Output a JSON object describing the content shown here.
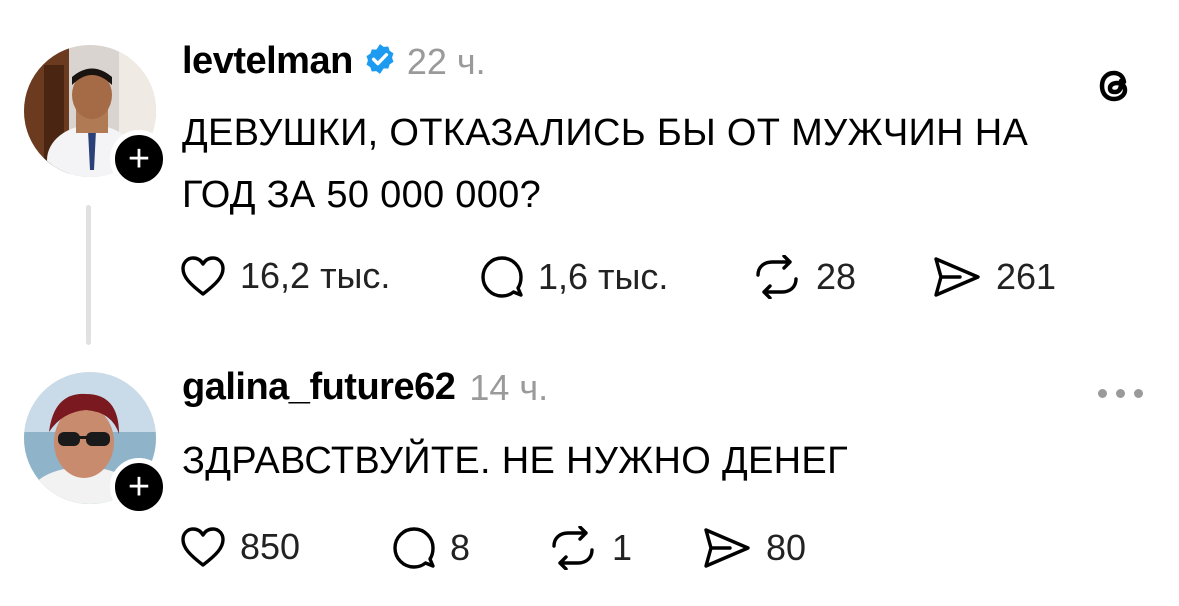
{
  "posts": [
    {
      "username": "levtelman",
      "verified": true,
      "time": "22 ч.",
      "text_line1": "ДЕВУШКИ, ОТКАЗАЛИСЬ БЫ ОТ МУЖЧИН НА",
      "text_line2": "ГОД ЗА 50 000 000?",
      "likes": "16,2 тыс.",
      "replies": "1,6 тыс.",
      "reposts": "28",
      "shares": "261"
    },
    {
      "username": "galina_future62",
      "verified": false,
      "time": "14 ч.",
      "text_line1": "ЗДРАВСТВУЙТЕ. НЕ НУЖНО ДЕНЕГ",
      "likes": "850",
      "replies": "8",
      "reposts": "1",
      "shares": "80"
    }
  ],
  "icons": {
    "brand": "threads-logo-icon",
    "like": "heart-icon",
    "reply": "comment-icon",
    "repost": "repost-icon",
    "share": "send-icon",
    "follow": "plus-icon",
    "more": "more-options-icon",
    "verified": "verified-badge-icon"
  },
  "colors": {
    "verified": "#1d9bf0",
    "muted": "#9a9a9a",
    "text": "#000000"
  }
}
